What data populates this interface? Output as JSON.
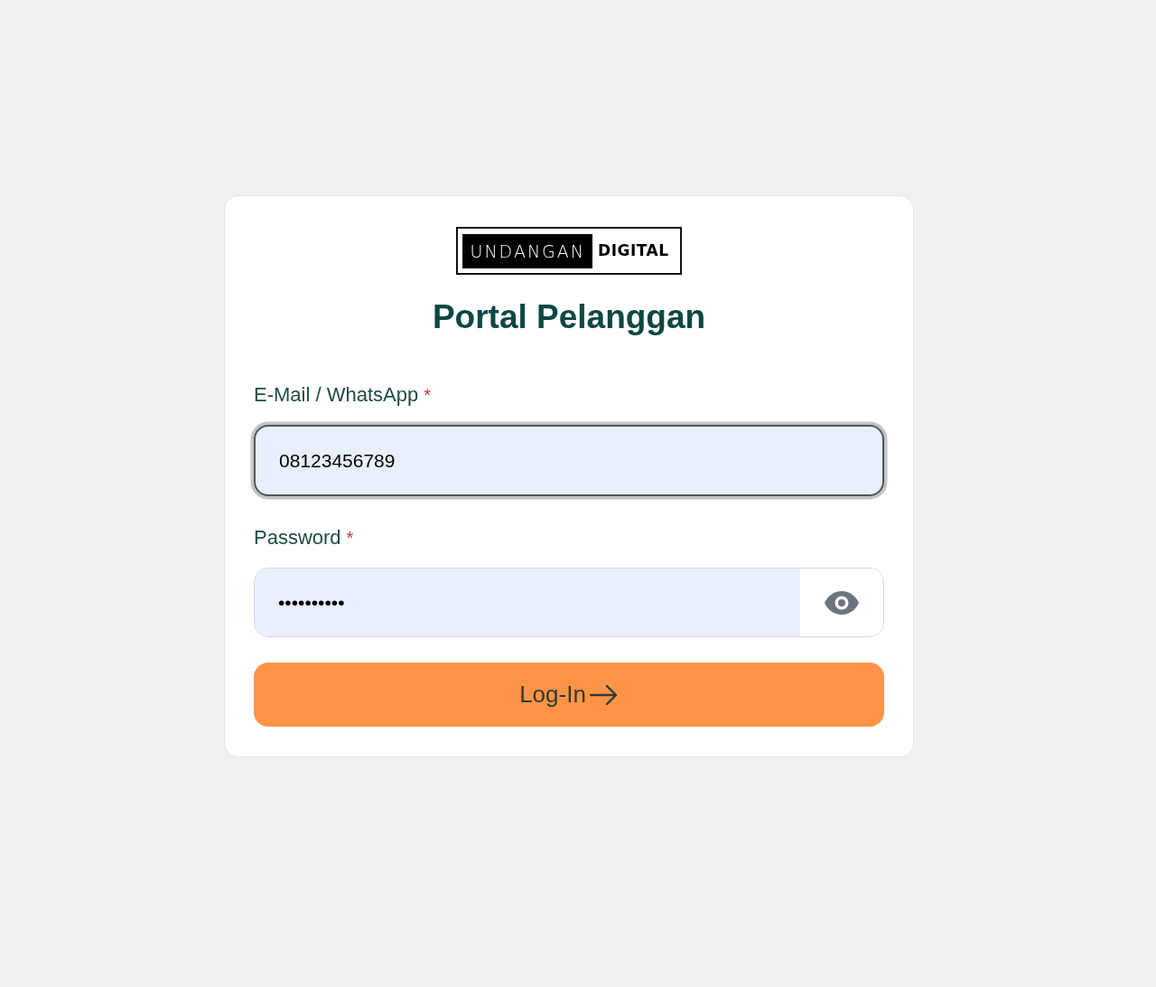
{
  "logo": {
    "highlight_word": "UNDANGAN",
    "word": "DIGITAL"
  },
  "title": "Portal Pelanggan",
  "fields": [
    {
      "kind": "text",
      "label": "E-Mail / WhatsApp",
      "required_mark": "*",
      "value": "08123456789",
      "focused": true
    },
    {
      "kind": "password",
      "label": "Password",
      "required_mark": "*",
      "value": "••••••••••",
      "focused": false
    }
  ],
  "submit_button": {
    "label": "Log-In"
  }
}
